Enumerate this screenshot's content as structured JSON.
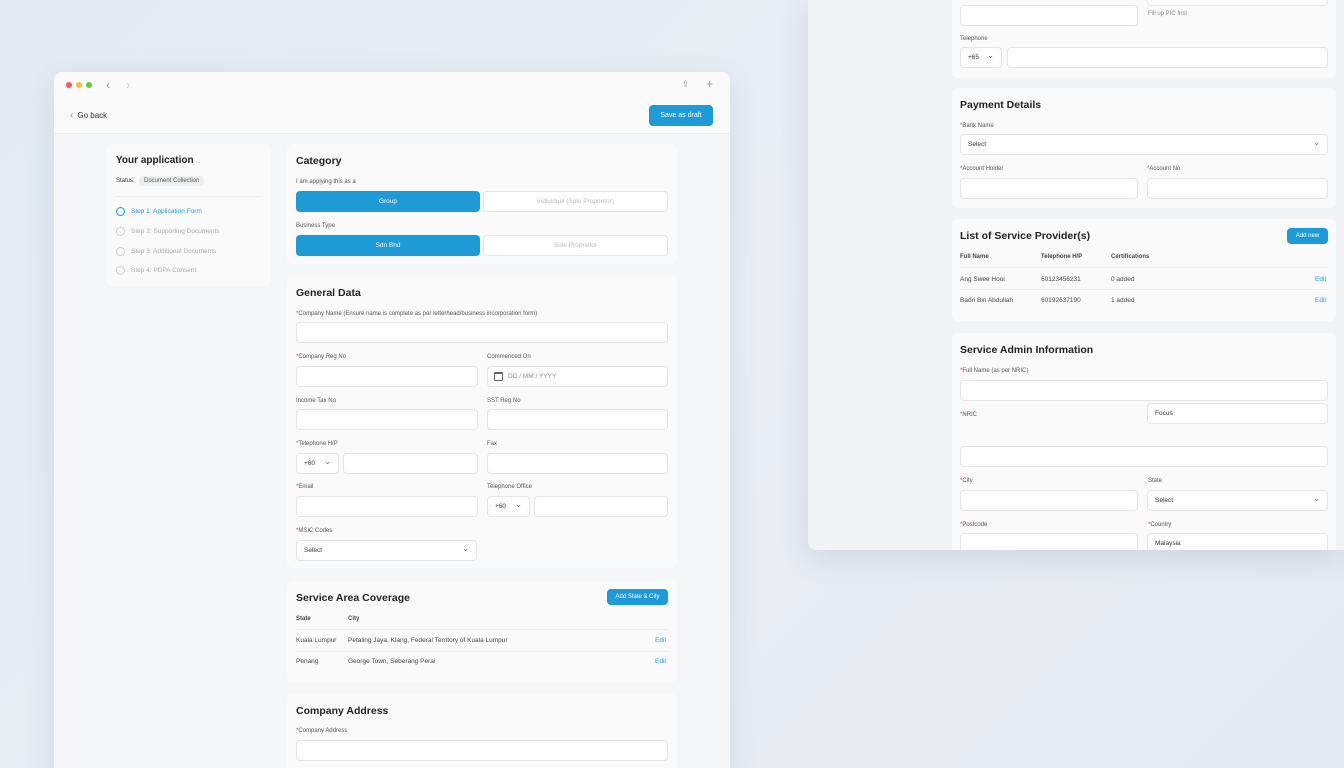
{
  "left_window": {
    "go_back": "Go back",
    "save_draft": "Save as draft",
    "application": {
      "title": "Your application",
      "status_label": "Status:",
      "status_value": "Document Collection",
      "steps": [
        "Step 1: Application Form",
        "Step 2: Supporting Documents",
        "Step 3: Additional Documents",
        "Step 4: PDPA Consent"
      ]
    },
    "category": {
      "title": "Category",
      "applying_as_label": "I am applying this as a",
      "applying_options": [
        "Group",
        "Individual (Sole Proprietor)"
      ],
      "business_type_label": "Business Type",
      "business_options": [
        "Sdn Bhd",
        "Sole Proprietor"
      ]
    },
    "general": {
      "title": "General Data",
      "company_name_label": "Company Name (Ensure name is complete as per letterhead/business incorporation form)",
      "company_reg_label": "Company Reg No",
      "commenced_label": "Commenced On",
      "commenced_placeholder": "DD / MM / YYYY",
      "income_tax_label": "Income Tax No",
      "sst_label": "SST Reg No",
      "tel_hp_label": "Telephone H/P",
      "tel_hp_code": "+60",
      "fax_label": "Fax",
      "email_label": "Email",
      "tel_office_label": "Telephone Office",
      "tel_office_code": "+60",
      "msic_label": "MSIC Codes",
      "msic_value": "Select"
    },
    "coverage": {
      "title": "Service Area Coverage",
      "add_button": "Add State & City",
      "col_state": "State",
      "col_city": "City",
      "rows": [
        {
          "state": "Kuala Lumpur",
          "city": "Petaling Jaya, Klang, Federal Territory of Kuala Lumpur",
          "action": "Edit"
        },
        {
          "state": "Penang",
          "city": "George Town, Seberang Perai",
          "action": "Edit"
        }
      ]
    },
    "address": {
      "title": "Company Address",
      "address_label": "Company Address"
    }
  },
  "right_window": {
    "pic_placeholder": "Fill up PIC first",
    "telephone_label": "Telephone",
    "telephone_code": "+65",
    "payment": {
      "title": "Payment Details",
      "bank_label": "Bank Name",
      "bank_value": "Select",
      "account_holder_label": "Account Holder",
      "account_no_label": "Account No"
    },
    "providers": {
      "title": "List of Service Provider(s)",
      "add_button": "Add new",
      "col_name": "Full Name",
      "col_phone": "Telephone H/P",
      "col_certs": "Certifications",
      "rows": [
        {
          "name": "Ang Swee Hooi",
          "phone": "60123456231",
          "certs": "0 added",
          "action": "Edit"
        },
        {
          "name": "Badri Bin Abdullah",
          "phone": "60192637190",
          "certs": "1 added",
          "action": "Edit"
        }
      ]
    },
    "admin": {
      "title": "Service Admin Information",
      "full_name_label": "Full Name (as per NRIC)",
      "nric_label": "NRIC",
      "role_value": "Focus",
      "city_label": "City",
      "state_label": "State",
      "state_value": "Select",
      "postcode_label": "Postcode",
      "country_label": "Country",
      "country_value": "Malaysia"
    }
  },
  "colors": {
    "accent": "#1e9ad6",
    "required": "#d33333",
    "background": "#e5ecf3"
  }
}
